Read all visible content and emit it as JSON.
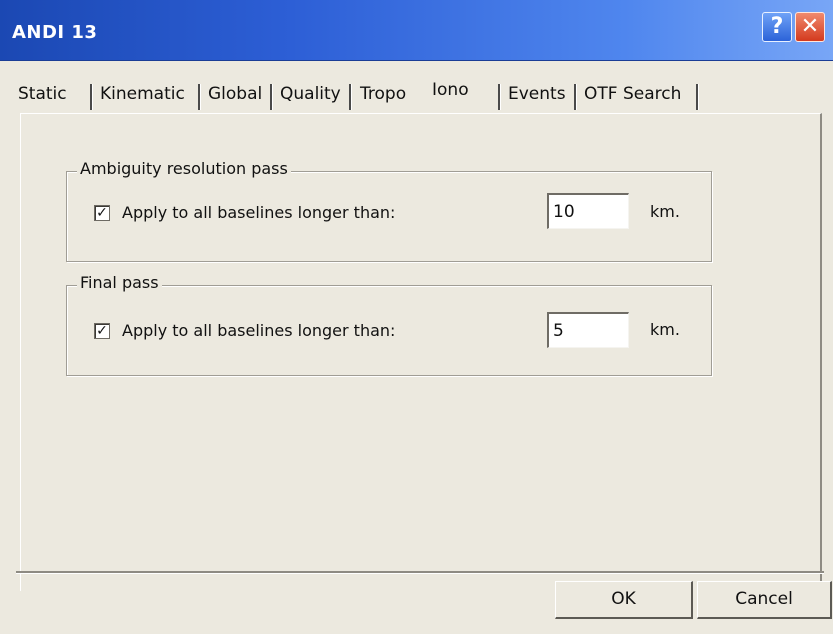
{
  "window": {
    "title": "ANDI 13",
    "help_label": "?",
    "close_label": "✕"
  },
  "tabs": [
    {
      "label": "Static"
    },
    {
      "label": "Kinematic"
    },
    {
      "label": "Global"
    },
    {
      "label": "Quality"
    },
    {
      "label": "Tropo"
    },
    {
      "label": "Iono",
      "active": true
    },
    {
      "label": "Events"
    },
    {
      "label": "OTF Search"
    }
  ],
  "groups": {
    "ambiguity": {
      "title": "Ambiguity resolution pass",
      "checkbox_label": "Apply to all baselines longer than:",
      "checked": true,
      "value": "10",
      "unit": "km."
    },
    "final": {
      "title": "Final pass",
      "checkbox_label": "Apply to all baselines longer than:",
      "checked": true,
      "value": "5",
      "unit": "km."
    }
  },
  "buttons": {
    "ok": "OK",
    "cancel": "Cancel"
  },
  "icons": {
    "check": "✓"
  },
  "colors": {
    "titlebar_start": "#1b48b3",
    "titlebar_end": "#78a6f6",
    "close_button": "#d43a1e",
    "dialog_face": "#ece9df"
  }
}
